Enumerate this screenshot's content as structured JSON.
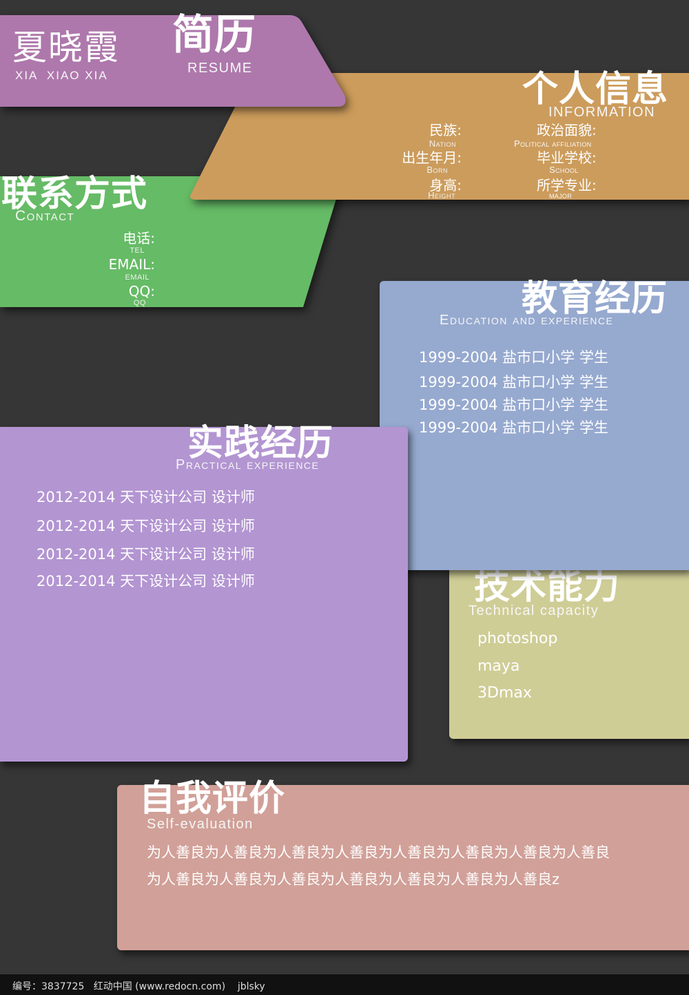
{
  "header": {
    "name_cn": "夏晓霞",
    "name_py": "XIA  XIAO XIA",
    "title_cn": "简历",
    "title_en": "RESUME"
  },
  "info": {
    "title_cn": "个人信息",
    "title_en": "INFORMATION",
    "left": [
      {
        "label": "民族:",
        "sub": "Nation"
      },
      {
        "label": "出生年月:",
        "sub": "Born"
      },
      {
        "label": "身高:",
        "sub": "Height"
      }
    ],
    "right": [
      {
        "label": "政治面貌:",
        "sub": "Political affiliation"
      },
      {
        "label": "毕业学校:",
        "sub": "School"
      },
      {
        "label": "所学专业:",
        "sub": "major"
      }
    ]
  },
  "contact": {
    "title_cn": "联系方式",
    "title_en": "Contact",
    "items": [
      {
        "label": "电话:",
        "sub": "TEL"
      },
      {
        "label": "EMAIL:",
        "sub": "EMAIL"
      },
      {
        "label": "QQ:",
        "sub": "QQ"
      }
    ]
  },
  "education": {
    "title_cn": "教育经历",
    "title_en": "Education and experience",
    "rows": [
      "1999-2004  盐市口小学   学生",
      "1999-2004  盐市口小学   学生",
      "1999-2004  盐市口小学   学生",
      "1999-2004  盐市口小学   学生"
    ]
  },
  "practice": {
    "title_cn": "实践经历",
    "title_en": "Practical experience",
    "rows": [
      "2012-2014  天下设计公司  设计师",
      "2012-2014  天下设计公司  设计师",
      "2012-2014  天下设计公司  设计师",
      "2012-2014  天下设计公司  设计师"
    ]
  },
  "skills": {
    "title_cn": "技术能力",
    "title_en": "Technical capacity",
    "rows": [
      "photoshop",
      "maya",
      "3Dmax"
    ]
  },
  "self": {
    "title_cn": "自我评价",
    "title_en": "Self-evaluation",
    "lines": [
      "为人善良为人善良为人善良为人善良为人善良为人善良为人善良为人善良",
      "为人善良为人善良为人善良为人善良为人善良为人善良为人善良z"
    ]
  },
  "footer": {
    "text": "编号：3837725   红动中国 (www.redocn.com)    jblsky"
  },
  "colors": {
    "background": "#363636",
    "header": "#ae78ac",
    "info": "#cc9c5c",
    "contact": "#66bb66",
    "education": "#96a9cf",
    "practice": "#b395d2",
    "skills": "#cfcd96",
    "self": "#d1a098"
  }
}
